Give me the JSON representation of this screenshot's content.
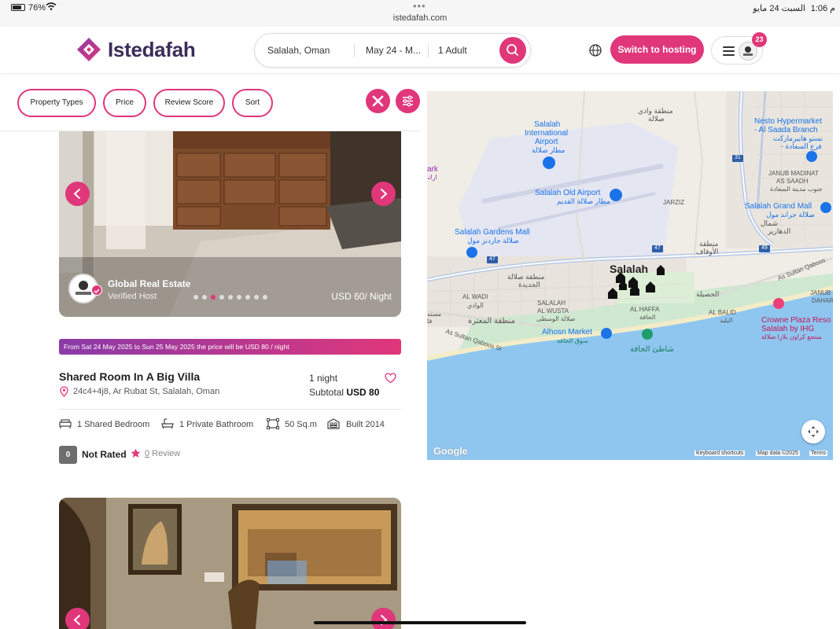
{
  "status_bar": {
    "battery": "76%",
    "url": "istedafah.com",
    "date": "السبت 24 مايو",
    "time": "م 1:06"
  },
  "header": {
    "logo_text": "Istedafah",
    "search": {
      "location": "Salalah, Oman",
      "dates": "May 24 - M...",
      "guests": "1 Adult"
    },
    "hosting_button": "Switch to hosting",
    "notification_count": "23"
  },
  "filters": {
    "property_types": "Property Types",
    "price": "Price",
    "review_score": "Review Score",
    "sort": "Sort"
  },
  "listing": {
    "host_name": "Global Real Estate",
    "host_status": "Verified Host",
    "price_per_night": "USD 60/ Night",
    "photo_count": 9,
    "active_photo": 2,
    "promo_text": "From Sat 24 May 2025 to Sun 25 May 2025 the price will be USD 80 / night",
    "title": "Shared Room In A Big Villa",
    "address": "24c4+4j8, Ar Rubat St, Salalah, Oman",
    "nights": "1 night",
    "subtotal_label": "Subtotal",
    "subtotal_value": "USD 80",
    "amenities": [
      "1 Shared Bedroom",
      "1 Private Bathroom",
      "50 Sq.m",
      "Built 2014"
    ],
    "rating": "0",
    "rating_label": "Not Rated",
    "review_count": "0",
    "review_word": " Review"
  },
  "map": {
    "city": "Salalah",
    "labels": {
      "airport_int_en1": "Salalah",
      "airport_int_en2": "International",
      "airport_int_en3": "Airport",
      "airport_int_ar": "مطار صلالة",
      "old_airport_en": "Salalah Old Airport",
      "old_airport_ar": "مطار صلالة القديم",
      "gardens_mall_en": "Salalah Gardens Mall",
      "gardens_mall_ar": "صلالة جاردنز مول",
      "nesto_en1": "Nesto Hypermarket",
      "nesto_en2": "- Al Saada Branch",
      "nesto_ar1": "نستو هايبرماركت",
      "nesto_ar2": "- فرع السعادة",
      "janub_madinat1": "JANUB MADINAT",
      "janub_madinat2": "AS SAADH",
      "janub_madinat_ar": "جنوب مدينة السعادة",
      "grand_mall_en": "Salalah Grand Mall",
      "grand_mall_ar": "صلالة جراند مول",
      "shamal_ar": "شمال",
      "dahariz_ar": "الدهاريز",
      "jarziz": "JARZIZ",
      "awqaf_ar1": "منطقة",
      "awqaf_ar2": "الأوقاف",
      "wadi_area_ar1": "منطقة وادي",
      "wadi_area_ar2": "صلالة",
      "new_salalah_ar1": "منطقة صلالة",
      "new_salalah_ar2": "الجديدة",
      "al_wadi": "AL WADI",
      "al_wadi_ar": "الوادي",
      "salalah_wusta1": "SALALAH",
      "salalah_wusta2": "AL WUSTA",
      "salalah_wusta_ar": "صلالة الوسطى",
      "muaitha_ar": "منطقة المعترة",
      "al_haffa": "AL HAFFA",
      "al_haffa_ar": "الحافة",
      "hasila_ar": "الحصيلة",
      "al_balid": "AL BALID",
      "al_balid_ar": "البليد",
      "alhosn_en": "Alhosn Market",
      "alhosn_ar": "سوق الحافة",
      "haffa_beach_ar": "شاطئ الحافة",
      "crowne1": "Crowne Plaza Reso",
      "crowne2": "Salalah by IHG",
      "crowne_ar": "منتجع كراون بلازا صلالة",
      "sultan_qaboos_w": "As Sultan Qaboos St",
      "sultan_qaboos_e": "As Sultan Qaboos",
      "janub_dahar1": "JANUB",
      "janub_dahar2": "DAHAR",
      "park_en": "ark",
      "park_ar": "ارك",
      "road_47a": "47",
      "road_47b": "47",
      "road_49": "49",
      "road_31": "31",
      "mustah": "مسته",
      "qa": "قا"
    },
    "footer": {
      "google": "Google",
      "shortcuts": "Keyboard shortcuts",
      "map_data": "Map data ©2025",
      "terms": "Terms"
    }
  },
  "colors": {
    "brand_pink": "#e0377a",
    "brand_purple": "#3b2d5a",
    "water": "#8fc6f0",
    "park": "#c8e6c9"
  },
  "icons": [
    "search-icon",
    "globe-icon",
    "menu-icon",
    "close-icon",
    "sliders-icon",
    "chevron-left-icon",
    "chevron-right-icon",
    "verified-check-icon",
    "location-pin-icon",
    "heart-icon",
    "bed-icon",
    "bath-icon",
    "area-icon",
    "building-icon",
    "star-icon",
    "fullscreen-icon"
  ]
}
